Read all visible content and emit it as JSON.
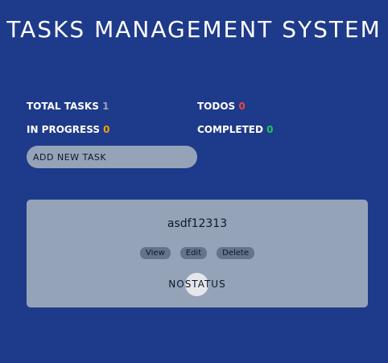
{
  "app": {
    "title": "TASKS MANAGEMENT SYSTEM"
  },
  "stats": {
    "total": {
      "label": "TOTAL TASKS",
      "count": "1",
      "color": "#94a3b8"
    },
    "todos": {
      "label": "TODOS",
      "count": "0",
      "color": "#ef4444"
    },
    "in_progress": {
      "label": "IN PROGRESS",
      "count": "0",
      "color": "#f59e0b"
    },
    "completed": {
      "label": "COMPLETED",
      "count": "0",
      "color": "#22c55e"
    }
  },
  "add_task": {
    "label": "ADD NEW TASK"
  },
  "tasks": [
    {
      "name": "asdf12313",
      "actions": {
        "view": "View",
        "edit": "Edit",
        "delete": "Delete"
      },
      "status": "NOSTATUS"
    }
  ],
  "colors": {
    "background": "#1e3a8a",
    "card": "#94a3b8",
    "button": "#64748b"
  }
}
